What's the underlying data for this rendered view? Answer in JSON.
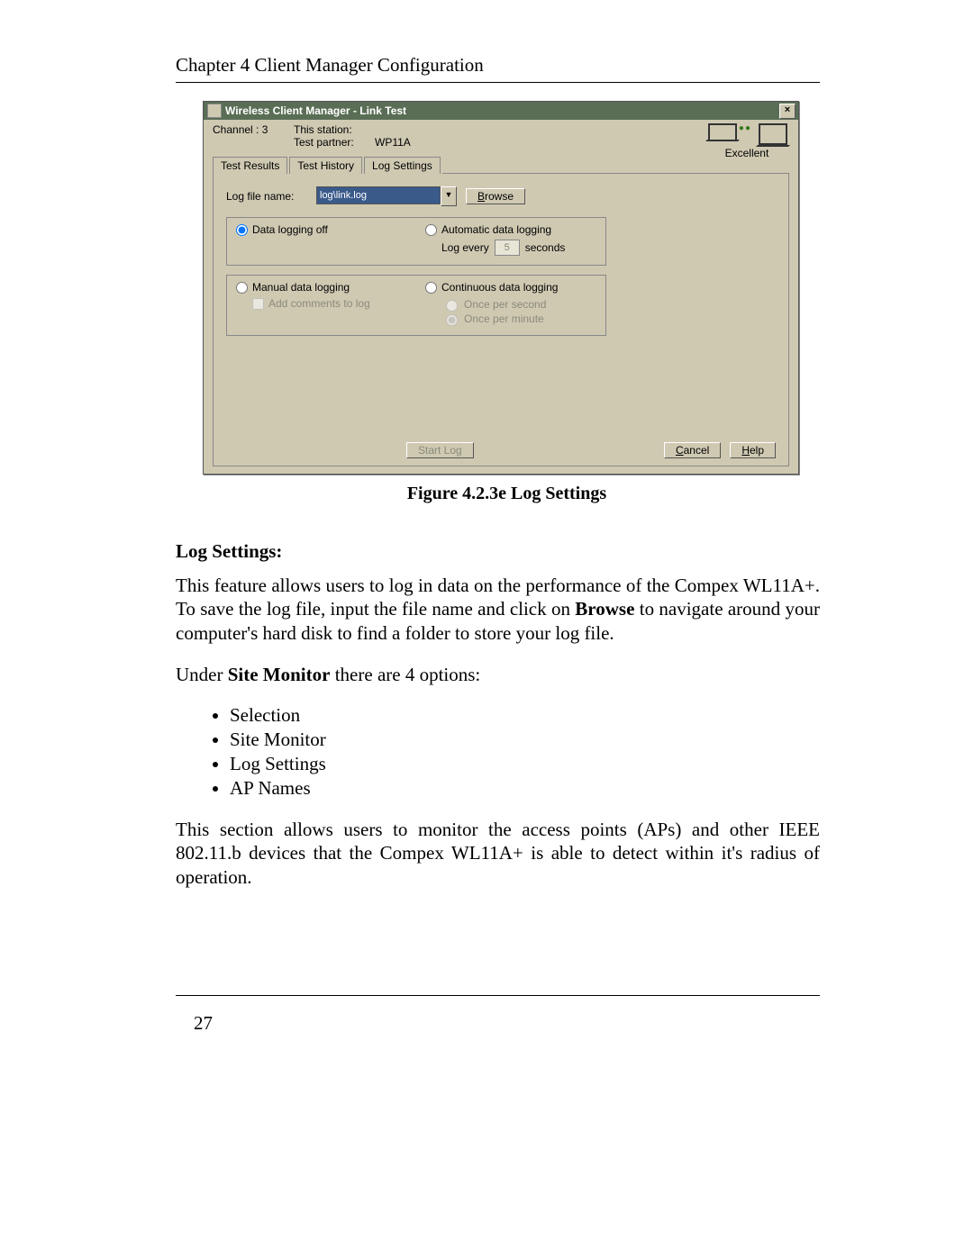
{
  "doc": {
    "chapter_header": "Chapter 4   Client Manager Configuration",
    "caption": "Figure 4.2.3e Log Settings",
    "section_head": "Log Settings:",
    "para1_a": "This feature allows users to log in data on the performance of the Compex WL11A+. To save the log file, input the file name and click on ",
    "para1_bold": "Browse",
    "para1_b": " to navigate around your computer's hard disk to find a folder to store your log file.",
    "para2_a": "Under ",
    "para2_bold": "Site Monitor",
    "para2_b": " there are 4 options:",
    "options": [
      "Selection",
      "Site Monitor",
      "Log Settings",
      "AP Names"
    ],
    "para3": "This section allows users to monitor the access points (APs) and other IEEE 802.11.b devices that the Compex WL11A+ is able to detect within it's radius of operation.",
    "page_number": "27"
  },
  "dialog": {
    "title": "Wireless Client Manager - Link Test",
    "close": "×",
    "channel_label": "Channel :",
    "channel_value": "3",
    "this_station_label": "This station:",
    "test_partner_label": "Test partner:",
    "test_partner_value": "WP11A",
    "status_text": "Excellent",
    "tabs": [
      "Test Results",
      "Test History",
      "Log Settings"
    ],
    "logfile_label": "Log file name:",
    "logfile_value": "log\\link.log",
    "browse_btn": "Browse",
    "opt_datalogging_off": "Data logging off",
    "opt_auto": "Automatic data logging",
    "auto_sub_a": "Log every",
    "auto_sub_val": "5",
    "auto_sub_b": "seconds",
    "opt_manual": "Manual data logging",
    "manual_sub": "Add comments to log",
    "opt_cont": "Continuous data logging",
    "cont_sub1": "Once per second",
    "cont_sub2": "Once per minute",
    "start_btn": "Start Log",
    "cancel_btn": "Cancel",
    "help_btn": "Help"
  }
}
